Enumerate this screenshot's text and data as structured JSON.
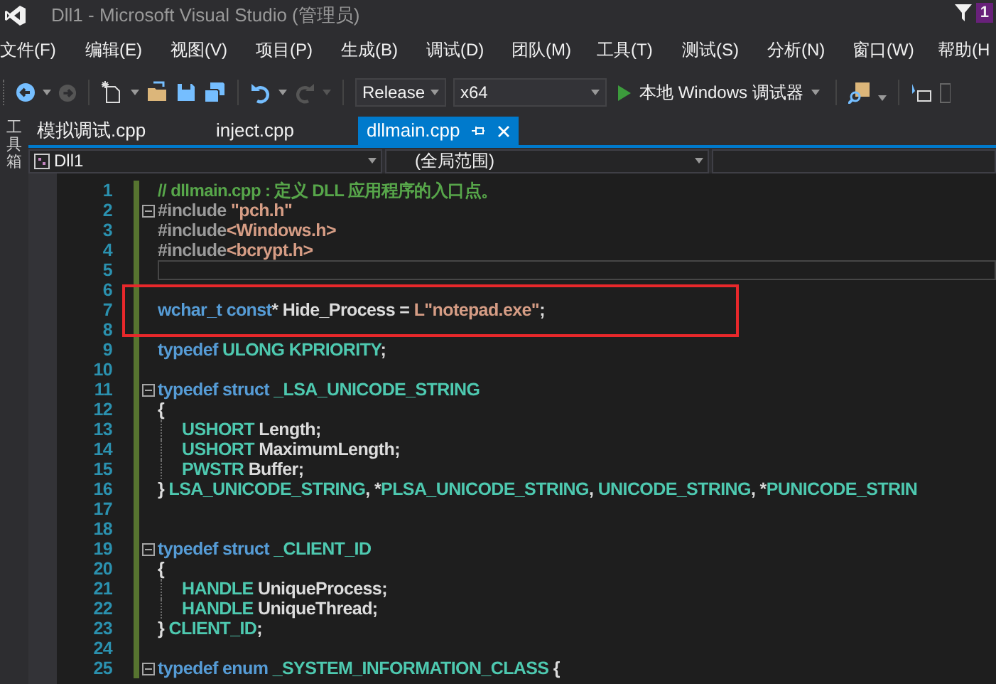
{
  "window": {
    "title": "Dll1 - Microsoft Visual Studio (管理员)",
    "notification_count": "1"
  },
  "menu": [
    "文件(F)",
    "编辑(E)",
    "视图(V)",
    "项目(P)",
    "生成(B)",
    "调试(D)",
    "团队(M)",
    "工具(T)",
    "测试(S)",
    "分析(N)",
    "窗口(W)",
    "帮助(H"
  ],
  "toolbar": {
    "configuration": "Release",
    "platform": "x64",
    "run_label": "本地 Windows 调试器"
  },
  "side_panel": {
    "label": "工具箱"
  },
  "tabs": [
    {
      "label": "模拟调试.cpp",
      "selected": false
    },
    {
      "label": "inject.cpp",
      "selected": false
    },
    {
      "label": "dllmain.cpp",
      "selected": true
    }
  ],
  "navigation": {
    "project": "Dll1",
    "scope": "(全局范围)"
  },
  "editor": {
    "lines": [
      {
        "number": "1",
        "fold": false,
        "indent": false,
        "current": false,
        "highlight": false,
        "tokens": [
          {
            "kind": "comment",
            "text": "// dllmain.cpp : 定义 DLL 应用程序的入口点。"
          }
        ]
      },
      {
        "number": "2",
        "fold": true,
        "indent": false,
        "current": false,
        "highlight": false,
        "tokens": [
          {
            "kind": "pre",
            "text": "#include "
          },
          {
            "kind": "string",
            "text": "\"pch.h\""
          }
        ]
      },
      {
        "number": "3",
        "fold": false,
        "indent": false,
        "current": false,
        "highlight": false,
        "tokens": [
          {
            "kind": "pre",
            "text": "#include"
          },
          {
            "kind": "string",
            "text": "<Windows.h>"
          }
        ]
      },
      {
        "number": "4",
        "fold": false,
        "indent": false,
        "current": false,
        "highlight": false,
        "tokens": [
          {
            "kind": "pre",
            "text": "#include"
          },
          {
            "kind": "string",
            "text": "<bcrypt.h>"
          }
        ]
      },
      {
        "number": "5",
        "fold": false,
        "indent": false,
        "current": true,
        "highlight": false
      },
      {
        "number": "6",
        "fold": false,
        "indent": false,
        "current": false,
        "highlight": false
      },
      {
        "number": "7",
        "fold": false,
        "indent": false,
        "current": false,
        "highlight": true,
        "tokens": [
          {
            "kind": "keyword",
            "text": "wchar_t const"
          },
          {
            "kind": "plain",
            "text": "* Hide_Process = "
          },
          {
            "kind": "string",
            "text": "L\"notepad.exe\""
          },
          {
            "kind": "plain",
            "text": ";"
          }
        ]
      },
      {
        "number": "8",
        "fold": false,
        "indent": false,
        "current": false,
        "highlight": false
      },
      {
        "number": "9",
        "fold": false,
        "indent": false,
        "current": false,
        "highlight": false,
        "tokens": [
          {
            "kind": "keyword",
            "text": "typedef "
          },
          {
            "kind": "type",
            "text": "ULONG KPRIORITY"
          },
          {
            "kind": "plain",
            "text": ";"
          }
        ]
      },
      {
        "number": "10",
        "fold": false,
        "indent": false,
        "current": false,
        "highlight": false
      },
      {
        "number": "11",
        "fold": true,
        "indent": false,
        "current": false,
        "highlight": false,
        "tokens": [
          {
            "kind": "keyword",
            "text": "typedef struct "
          },
          {
            "kind": "type",
            "text": "_LSA_UNICODE_STRING"
          }
        ]
      },
      {
        "number": "12",
        "fold": false,
        "indent": false,
        "current": false,
        "highlight": false,
        "tokens": [
          {
            "kind": "plain",
            "text": "{"
          }
        ]
      },
      {
        "number": "13",
        "fold": false,
        "indent": true,
        "current": false,
        "highlight": false,
        "tokens": [
          {
            "kind": "type",
            "text": "USHORT"
          },
          {
            "kind": "plain",
            "text": " Length;"
          }
        ]
      },
      {
        "number": "14",
        "fold": false,
        "indent": true,
        "current": false,
        "highlight": false,
        "tokens": [
          {
            "kind": "type",
            "text": "USHORT"
          },
          {
            "kind": "plain",
            "text": " MaximumLength;"
          }
        ]
      },
      {
        "number": "15",
        "fold": false,
        "indent": true,
        "current": false,
        "highlight": false,
        "tokens": [
          {
            "kind": "type",
            "text": "PWSTR"
          },
          {
            "kind": "plain",
            "text": " Buffer;"
          }
        ]
      },
      {
        "number": "16",
        "fold": false,
        "indent": false,
        "current": false,
        "highlight": false,
        "tokens": [
          {
            "kind": "plain",
            "text": "} "
          },
          {
            "kind": "type",
            "text": "LSA_UNICODE_STRING"
          },
          {
            "kind": "plain",
            "text": ", *"
          },
          {
            "kind": "type",
            "text": "PLSA_UNICODE_STRING"
          },
          {
            "kind": "plain",
            "text": ", "
          },
          {
            "kind": "type",
            "text": "UNICODE_STRING"
          },
          {
            "kind": "plain",
            "text": ", *"
          },
          {
            "kind": "type",
            "text": "PUNICODE_STRIN"
          }
        ]
      },
      {
        "number": "17",
        "fold": false,
        "indent": false,
        "current": false,
        "highlight": false
      },
      {
        "number": "18",
        "fold": false,
        "indent": false,
        "current": false,
        "highlight": false
      },
      {
        "number": "19",
        "fold": true,
        "indent": false,
        "current": false,
        "highlight": false,
        "tokens": [
          {
            "kind": "keyword",
            "text": "typedef struct "
          },
          {
            "kind": "type",
            "text": "_CLIENT_ID"
          }
        ]
      },
      {
        "number": "20",
        "fold": false,
        "indent": false,
        "current": false,
        "highlight": false,
        "tokens": [
          {
            "kind": "plain",
            "text": "{"
          }
        ]
      },
      {
        "number": "21",
        "fold": false,
        "indent": true,
        "current": false,
        "highlight": false,
        "tokens": [
          {
            "kind": "type",
            "text": "HANDLE"
          },
          {
            "kind": "plain",
            "text": " UniqueProcess;"
          }
        ]
      },
      {
        "number": "22",
        "fold": false,
        "indent": true,
        "current": false,
        "highlight": false,
        "tokens": [
          {
            "kind": "type",
            "text": "HANDLE"
          },
          {
            "kind": "plain",
            "text": " UniqueThread;"
          }
        ]
      },
      {
        "number": "23",
        "fold": false,
        "indent": false,
        "current": false,
        "highlight": false,
        "tokens": [
          {
            "kind": "plain",
            "text": "} "
          },
          {
            "kind": "type",
            "text": "CLIENT_ID"
          },
          {
            "kind": "plain",
            "text": ";"
          }
        ]
      },
      {
        "number": "24",
        "fold": false,
        "indent": false,
        "current": false,
        "highlight": false
      },
      {
        "number": "25",
        "fold": true,
        "indent": false,
        "current": false,
        "highlight": false,
        "tokens": [
          {
            "kind": "keyword",
            "text": "typedef enum "
          },
          {
            "kind": "type",
            "text": "_SYSTEM_INFORMATION_CLASS"
          },
          {
            "kind": "plain",
            "text": " {"
          }
        ]
      }
    ]
  }
}
